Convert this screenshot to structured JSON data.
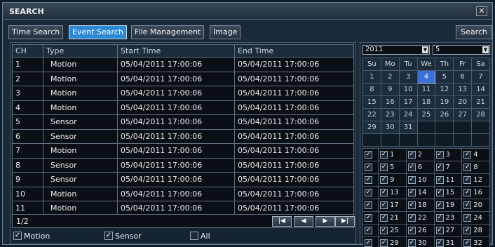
{
  "window": {
    "title": "SEARCH",
    "close_glyph": "✕"
  },
  "tabs": [
    {
      "label": "Time Search"
    },
    {
      "label": "Event Search"
    },
    {
      "label": "File Management"
    },
    {
      "label": "Image"
    }
  ],
  "search_button": "Search",
  "table": {
    "headers": [
      "CH",
      "Type",
      "Start Time",
      "End Time"
    ],
    "rows": [
      [
        "1",
        "Motion",
        "05/04/2011 17:00:06",
        "05/04/2011 17:00:06"
      ],
      [
        "2",
        "Motion",
        "05/04/2011 17:00:06",
        "05/04/2011 17:00:06"
      ],
      [
        "3",
        "Motion",
        "05/04/2011 17:00:06",
        "05/04/2011 17:00:06"
      ],
      [
        "4",
        "Motion",
        "05/04/2011 17:00:06",
        "05/04/2011 17:00:06"
      ],
      [
        "5",
        "Sensor",
        "05/04/2011 17:00:06",
        "05/04/2011 17:00:06"
      ],
      [
        "6",
        "Sensor",
        "05/04/2011 17:00:06",
        "05/04/2011 17:00:06"
      ],
      [
        "7",
        "Motion",
        "05/04/2011 17:00:06",
        "05/04/2011 17:00:06"
      ],
      [
        "8",
        "Sensor",
        "05/04/2011 17:00:06",
        "05/04/2011 17:00:06"
      ],
      [
        "9",
        "Sensor",
        "05/04/2011 17:00:06",
        "05/04/2011 17:00:06"
      ],
      [
        "10",
        "Motion",
        "05/04/2011 17:00:06",
        "05/04/2011 17:00:06"
      ],
      [
        "11",
        "Motion",
        "05/04/2011 17:00:06",
        "05/04/2011 17:00:06"
      ]
    ]
  },
  "pager": {
    "page": "1/2",
    "buttons": [
      {
        "name": "first-page-icon",
        "glyph": "|◀"
      },
      {
        "name": "prev-page-icon",
        "glyph": "◀"
      },
      {
        "name": "next-page-icon",
        "glyph": "▶"
      },
      {
        "name": "last-page-icon",
        "glyph": "▶|"
      }
    ]
  },
  "filters": [
    {
      "label": "Motion",
      "checked": true
    },
    {
      "label": "Sensor",
      "checked": true
    },
    {
      "label": "All",
      "checked": false
    }
  ],
  "calendar": {
    "year": "2011",
    "month": "5",
    "weekdays": [
      "Su",
      "Mo",
      "Tu",
      "We",
      "Th",
      "Fr",
      "Sa"
    ],
    "weeks": [
      [
        "1",
        "2",
        "3",
        "4",
        "5",
        "6",
        "7"
      ],
      [
        "8",
        "9",
        "10",
        "11",
        "12",
        "13",
        "14"
      ],
      [
        "15",
        "16",
        "17",
        "18",
        "19",
        "20",
        "21"
      ],
      [
        "22",
        "23",
        "24",
        "25",
        "26",
        "27",
        "28"
      ],
      [
        "29",
        "30",
        "31",
        "",
        "",
        "",
        ""
      ],
      [
        "",
        "",
        "",
        "",
        "",
        "",
        ""
      ]
    ],
    "selected_day": "4"
  },
  "channels": {
    "rows": [
      [
        "1",
        "2",
        "3",
        "4"
      ],
      [
        "5",
        "6",
        "7",
        "8"
      ],
      [
        "9",
        "10",
        "11",
        "12"
      ],
      [
        "13",
        "14",
        "15",
        "16"
      ],
      [
        "17",
        "18",
        "19",
        "20"
      ],
      [
        "21",
        "22",
        "23",
        "24"
      ],
      [
        "25",
        "26",
        "27",
        "28"
      ],
      [
        "29",
        "30",
        "31",
        "32"
      ]
    ],
    "checked": true
  },
  "colors": {
    "accent": "#2f8ad6",
    "selected_day": "#3b6fd6"
  }
}
